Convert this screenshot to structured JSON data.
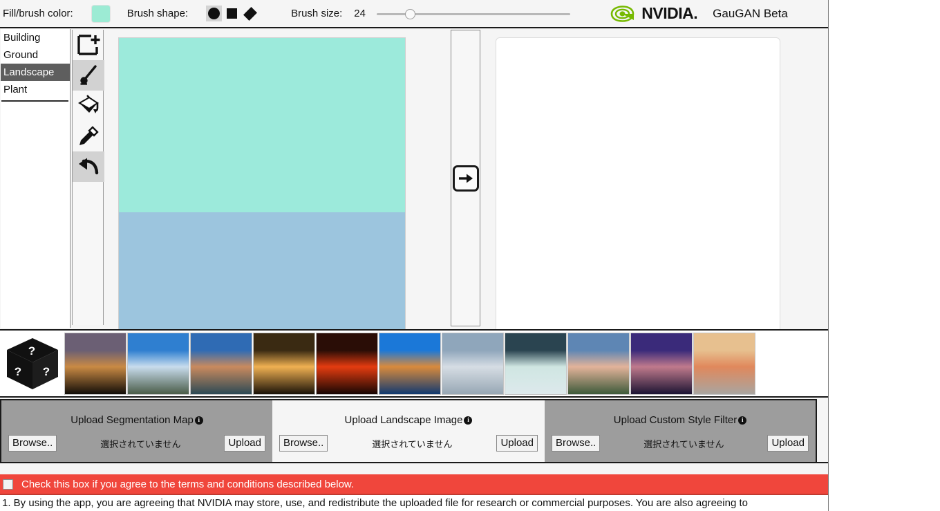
{
  "toolbar": {
    "fill_label": "Fill/brush color:",
    "fill_color": "#9cebd4",
    "shape_label": "Brush shape:",
    "shapes": [
      {
        "name": "circle",
        "selected": true
      },
      {
        "name": "square",
        "selected": false
      },
      {
        "name": "diamond",
        "selected": false
      }
    ],
    "size_label": "Brush size:",
    "size_value": "24",
    "slider_percent": 14.5,
    "brand_word": "NVIDIA.",
    "brand_green": "#76b900",
    "app_title": "GauGAN Beta"
  },
  "labels": {
    "items": [
      {
        "label": "Building",
        "selected": false
      },
      {
        "label": "Ground",
        "selected": false
      },
      {
        "label": "Landscape",
        "selected": true
      },
      {
        "label": "Plant",
        "selected": false
      }
    ]
  },
  "tools": [
    {
      "name": "new-canvas",
      "selected": false
    },
    {
      "name": "brush",
      "selected": true
    },
    {
      "name": "paint-bucket",
      "selected": false
    },
    {
      "name": "eyedropper",
      "selected": false
    },
    {
      "name": "undo",
      "selected": true
    }
  ],
  "canvas": {
    "sky_color": "#9ceadb",
    "water_color": "#9cc5de"
  },
  "render": {
    "arrow_label": "render"
  },
  "style_strip": {
    "dice_label": "random-style",
    "thumbs": [
      {
        "name": "sunset-trees",
        "top": "#6b5f74",
        "mid": "#c98a44",
        "bottom": "#120d08"
      },
      {
        "name": "highway-clouds",
        "top": "#2f7fd0",
        "mid": "#c8dced",
        "bottom": "#4a5c48"
      },
      {
        "name": "dusk-coast",
        "top": "#2f6bb4",
        "mid": "#c98a5e",
        "bottom": "#2c4a55"
      },
      {
        "name": "golden-sunset-sea",
        "top": "#3a2a12",
        "mid": "#f0b152",
        "bottom": "#1a1208"
      },
      {
        "name": "red-sun-dark",
        "top": "#2a0d06",
        "mid": "#e43c10",
        "bottom": "#170603"
      },
      {
        "name": "blue-lake-cliff",
        "top": "#1b78d8",
        "mid": "#d98a3c",
        "bottom": "#123a70"
      },
      {
        "name": "pale-overcast-shore",
        "top": "#8fa6bb",
        "mid": "#d6dde4",
        "bottom": "#97a7b4"
      },
      {
        "name": "snow-night-star",
        "top": "#2a4450",
        "mid": "#cfe6e2",
        "bottom": "#dde9ec"
      },
      {
        "name": "pink-clouds-lake",
        "top": "#5e86b4",
        "mid": "#e3b39a",
        "bottom": "#3d5a3a"
      },
      {
        "name": "purple-dusk-reflection",
        "top": "#3a2a7a",
        "mid": "#c07a8c",
        "bottom": "#1c1433"
      },
      {
        "name": "beach-sunset-people",
        "top": "#e7c08f",
        "mid": "#e0885c",
        "bottom": "#a9a5a0"
      }
    ]
  },
  "uploads": [
    {
      "title": "Upload Segmentation Map",
      "info": "i",
      "browse": "Browse..",
      "nofile": "選択されていません",
      "upload": "Upload",
      "style": "grey"
    },
    {
      "title": "Upload Landscape Image",
      "info": "i",
      "browse": "Browse..",
      "nofile": "選択されていません",
      "upload": "Upload",
      "style": "light"
    },
    {
      "title": "Upload Custom Style Filter",
      "info": "i",
      "browse": "Browse..",
      "nofile": "選択されていません",
      "upload": "Upload",
      "style": "grey"
    }
  ],
  "terms": {
    "bar_color": "#f0463c",
    "checkbox_checked": false,
    "agree_text": "Check this box if you agree to the terms and conditions described below.",
    "clause_1": "1. By using the app, you are agreeing that NVIDIA may store, use, and redistribute the uploaded file for research or commercial purposes. You are also agreeing to"
  }
}
